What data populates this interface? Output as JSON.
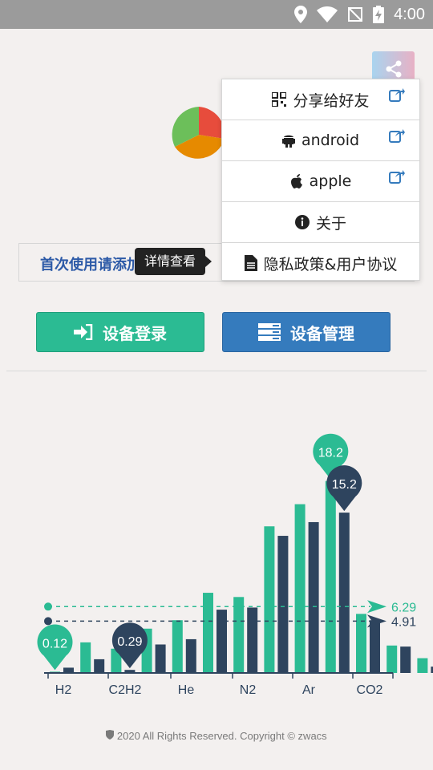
{
  "status_bar": {
    "time": "4:00"
  },
  "notice": {
    "text": "首次使用请添加设备"
  },
  "tooltip": {
    "text": "详情查看"
  },
  "menu": {
    "items": [
      {
        "label": "分享给好友",
        "icon": "qrcode-icon",
        "external": true
      },
      {
        "label": "android",
        "icon": "android-icon",
        "external": true
      },
      {
        "label": "apple",
        "icon": "apple-icon",
        "external": true
      },
      {
        "label": "关于",
        "icon": "info-icon",
        "external": false
      },
      {
        "label": "隐私政策&用户协议",
        "icon": "document-icon",
        "external": false
      }
    ]
  },
  "buttons": {
    "login": "设备登录",
    "manage": "设备管理"
  },
  "chart_data": {
    "type": "bar",
    "categories": [
      "H2",
      "C2H2",
      "He",
      "N2",
      "Ar",
      "CO2"
    ],
    "bar_labels": [
      "H2",
      "",
      "C2H2",
      "",
      "He",
      "",
      "",
      "N2",
      "",
      "Ar",
      "",
      "CO2"
    ],
    "series": [
      {
        "color": "#2bbb93",
        "values": [
          0.12,
          2.9,
          2.3,
          4.2,
          5.0,
          7.6,
          7.2,
          13.9,
          16.0,
          18.2,
          5.6,
          2.6,
          1.4
        ]
      },
      {
        "color": "#2e445e",
        "values": [
          0.5,
          1.3,
          0.29,
          2.7,
          3.2,
          6.0,
          6.2,
          13.0,
          14.3,
          15.2,
          5.0,
          2.5,
          0.6
        ]
      }
    ],
    "pins": [
      {
        "value": "0.12",
        "series": 0,
        "index": 0
      },
      {
        "value": "0.29",
        "series": 1,
        "index": 2
      },
      {
        "value": "18.2",
        "series": 0,
        "index": 9
      },
      {
        "value": "15.2",
        "series": 1,
        "index": 9
      }
    ],
    "reference_lines": [
      {
        "value": 6.29,
        "label": "6.29",
        "color": "#2bbb93"
      },
      {
        "value": 4.91,
        "label": "4.91",
        "color": "#2e445e"
      }
    ],
    "ylim": [
      0,
      20
    ]
  },
  "footer": {
    "text": "2020 All Rights Reserved. Copyright © zwacs"
  }
}
